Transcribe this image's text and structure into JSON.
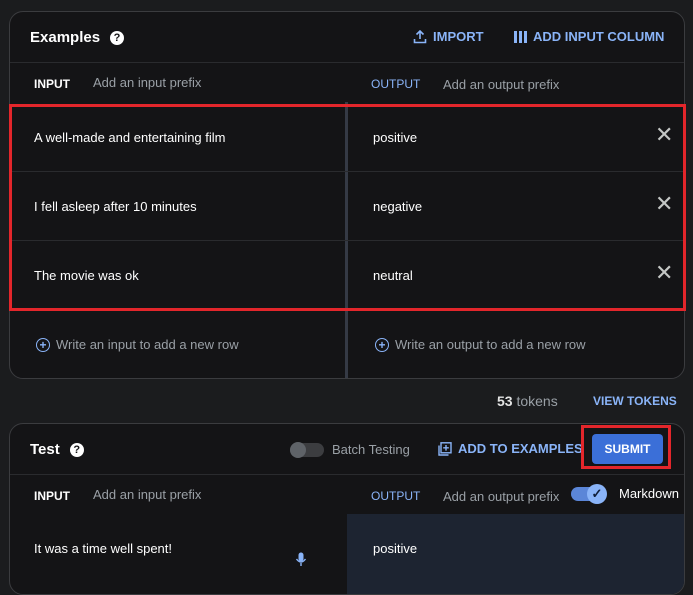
{
  "examples": {
    "title": "Examples",
    "import_label": "IMPORT",
    "add_column_label": "ADD INPUT COLUMN",
    "input_header": "INPUT",
    "input_prefix_placeholder": "Add an input prefix",
    "output_header": "OUTPUT",
    "output_prefix_placeholder": "Add an output prefix",
    "rows": [
      {
        "input": "A well-made and entertaining film",
        "output": "positive"
      },
      {
        "input": "I fell asleep after 10 minutes",
        "output": "negative"
      },
      {
        "input": "The movie was ok",
        "output": "neutral"
      }
    ],
    "add_input_placeholder": "Write an input to add a new row",
    "add_output_placeholder": "Write an output to add a new row"
  },
  "tokens": {
    "count": "53",
    "label": "tokens",
    "view_label": "VIEW TOKENS"
  },
  "test": {
    "title": "Test",
    "batch_label": "Batch Testing",
    "add_to_examples_label": "ADD TO EXAMPLES",
    "submit_label": "SUBMIT",
    "input_header": "INPUT",
    "input_prefix_placeholder": "Add an input prefix",
    "output_header": "OUTPUT",
    "output_prefix_placeholder": "Add an output prefix",
    "markdown_label": "Markdown",
    "input_value": "It was a time well spent!",
    "output_value": "positive"
  },
  "colors": {
    "accent": "#8ab4f8",
    "submit": "#3b6fd8",
    "highlight": "#e3262b"
  }
}
